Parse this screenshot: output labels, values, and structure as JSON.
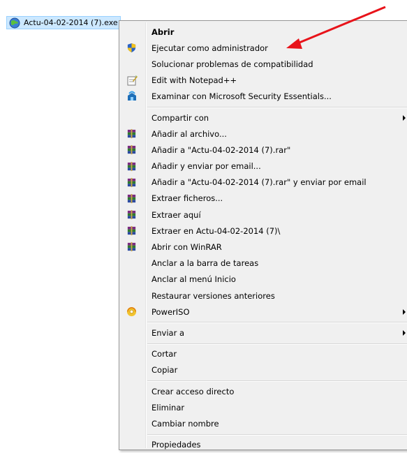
{
  "file": {
    "label": "Actu-04-02-2014 (7).exe",
    "icon": "installer-globe-icon"
  },
  "menu": {
    "groups": [
      [
        {
          "label": "Abrir",
          "bold": true,
          "icon": ""
        },
        {
          "label": "Ejecutar como administrador",
          "icon": "uac-shield-icon"
        },
        {
          "label": "Solucionar problemas de compatibilidad",
          "icon": ""
        },
        {
          "label": "Edit with Notepad++",
          "icon": "notepad-icon"
        },
        {
          "label": "Examinar con Microsoft Security Essentials...",
          "icon": "security-essentials-icon"
        }
      ],
      [
        {
          "label": "Compartir con",
          "icon": "",
          "submenu": true
        },
        {
          "label": "Añadir al archivo...",
          "icon": "winrar-icon"
        },
        {
          "label": "Añadir a \"Actu-04-02-2014 (7).rar\"",
          "icon": "winrar-icon"
        },
        {
          "label": "Añadir y enviar por email...",
          "icon": "winrar-icon"
        },
        {
          "label": "Añadir a \"Actu-04-02-2014 (7).rar\" y enviar por email",
          "icon": "winrar-icon"
        },
        {
          "label": "Extraer ficheros...",
          "icon": "winrar-icon"
        },
        {
          "label": "Extraer aquí",
          "icon": "winrar-icon"
        },
        {
          "label": "Extraer en Actu-04-02-2014 (7)\\",
          "icon": "winrar-icon"
        },
        {
          "label": "Abrir con WinRAR",
          "icon": "winrar-icon"
        },
        {
          "label": "Anclar a la barra de tareas",
          "icon": ""
        },
        {
          "label": "Anclar al menú Inicio",
          "icon": ""
        },
        {
          "label": "Restaurar versiones anteriores",
          "icon": ""
        },
        {
          "label": "PowerISO",
          "icon": "poweriso-icon",
          "submenu": true
        }
      ],
      [
        {
          "label": "Enviar a",
          "icon": "",
          "submenu": true
        }
      ],
      [
        {
          "label": "Cortar",
          "icon": ""
        },
        {
          "label": "Copiar",
          "icon": ""
        }
      ],
      [
        {
          "label": "Crear acceso directo",
          "icon": ""
        },
        {
          "label": "Eliminar",
          "icon": ""
        },
        {
          "label": "Cambiar nombre",
          "icon": ""
        }
      ],
      [
        {
          "label": "Propiedades",
          "icon": ""
        }
      ]
    ]
  },
  "annotation": {
    "arrow_color": "#e8131a"
  }
}
